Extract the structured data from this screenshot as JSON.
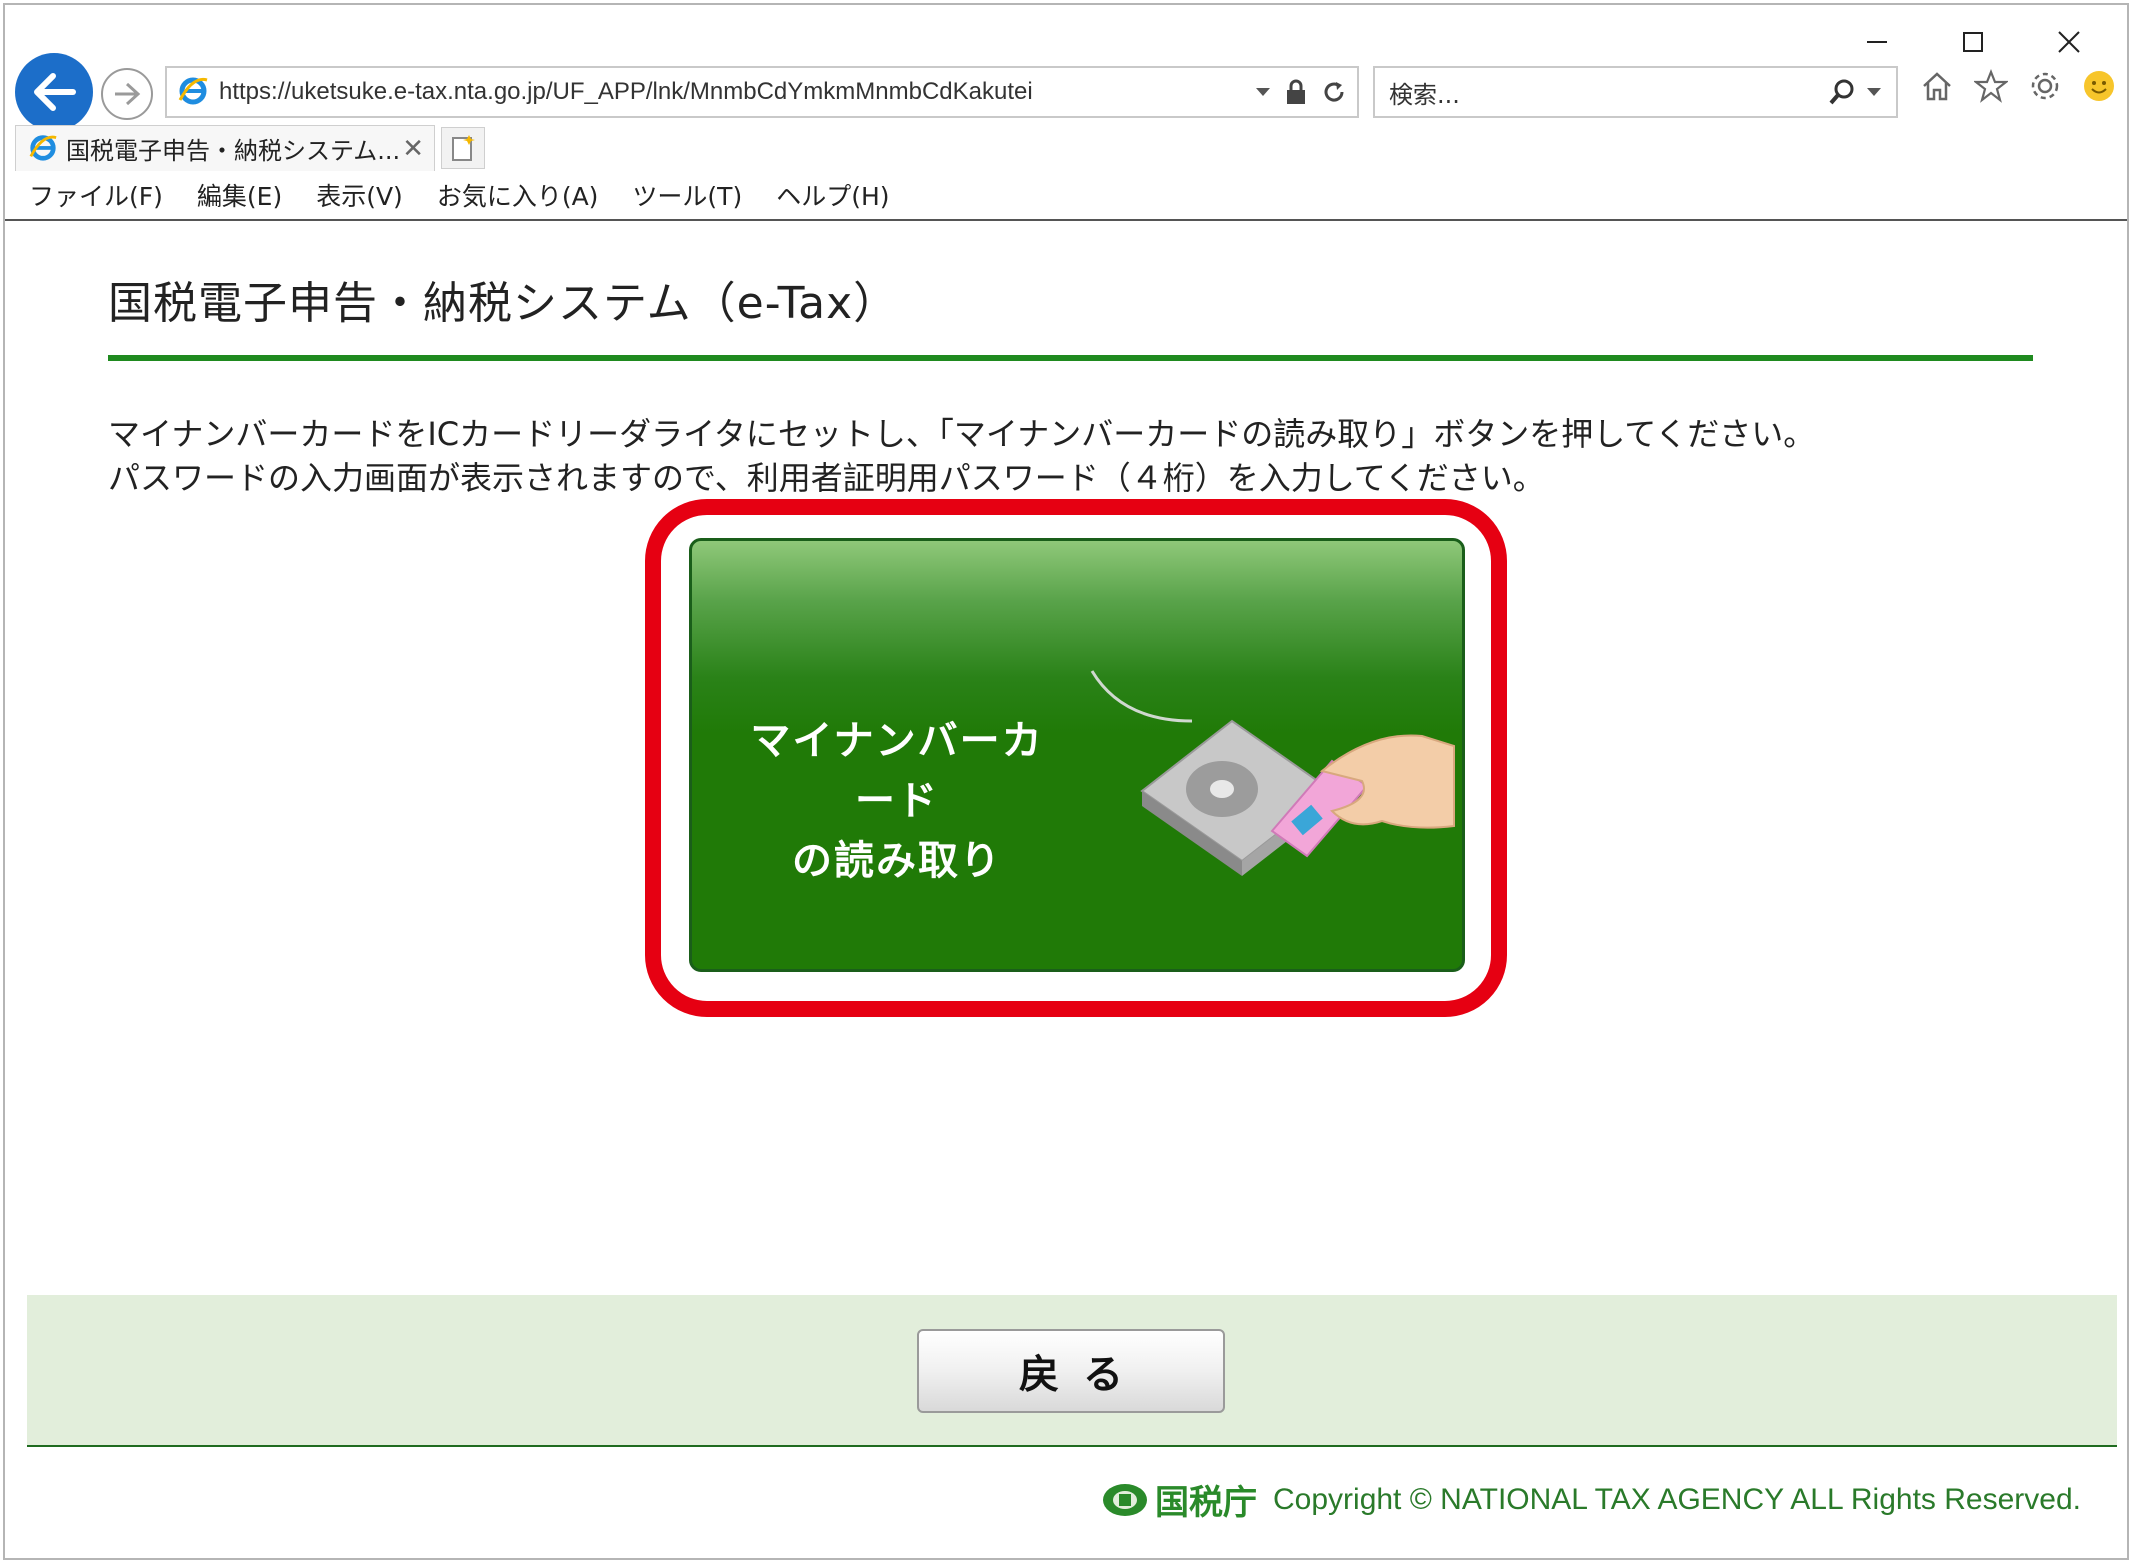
{
  "window": {
    "controls": {
      "minimize": "–",
      "maximize": "☐",
      "close": "✕"
    }
  },
  "browser": {
    "url": "https://uketsuke.e-tax.nta.go.jp/UF_APP/lnk/MnmbCdYmkmMnmbCdKakutei",
    "search_placeholder": "検索...",
    "tab_title": "国税電子申告・納税システム...",
    "tab_close": "✕",
    "menu": [
      "ファイル(F)",
      "編集(E)",
      "表示(V)",
      "お気に入り(A)",
      "ツール(T)",
      "ヘルプ(H)"
    ]
  },
  "page": {
    "title": "国税電子申告・納税システム（e-Tax）",
    "instructions": [
      "マイナンバーカードをICカードリーダライタにセットし、「マイナンバーカードの読み取り」ボタンを押してください。",
      "パスワードの入力画面が表示されますので、利用者証明用パスワード（４桁）を入力してください。"
    ],
    "read_button": {
      "line1": "マイナンバーカード",
      "line2": "の読み取り"
    },
    "back_button": "戻る"
  },
  "footer": {
    "agency": "国税庁",
    "copyright": "Copyright © NATIONAL TAX AGENCY ALL Rights Reserved."
  },
  "colors": {
    "accent_green": "#1f8a1f",
    "button_green": "#207a07",
    "highlight_red": "#e60012",
    "footer_bg": "#e2eedb",
    "ie_blue": "#1c6ec9"
  }
}
